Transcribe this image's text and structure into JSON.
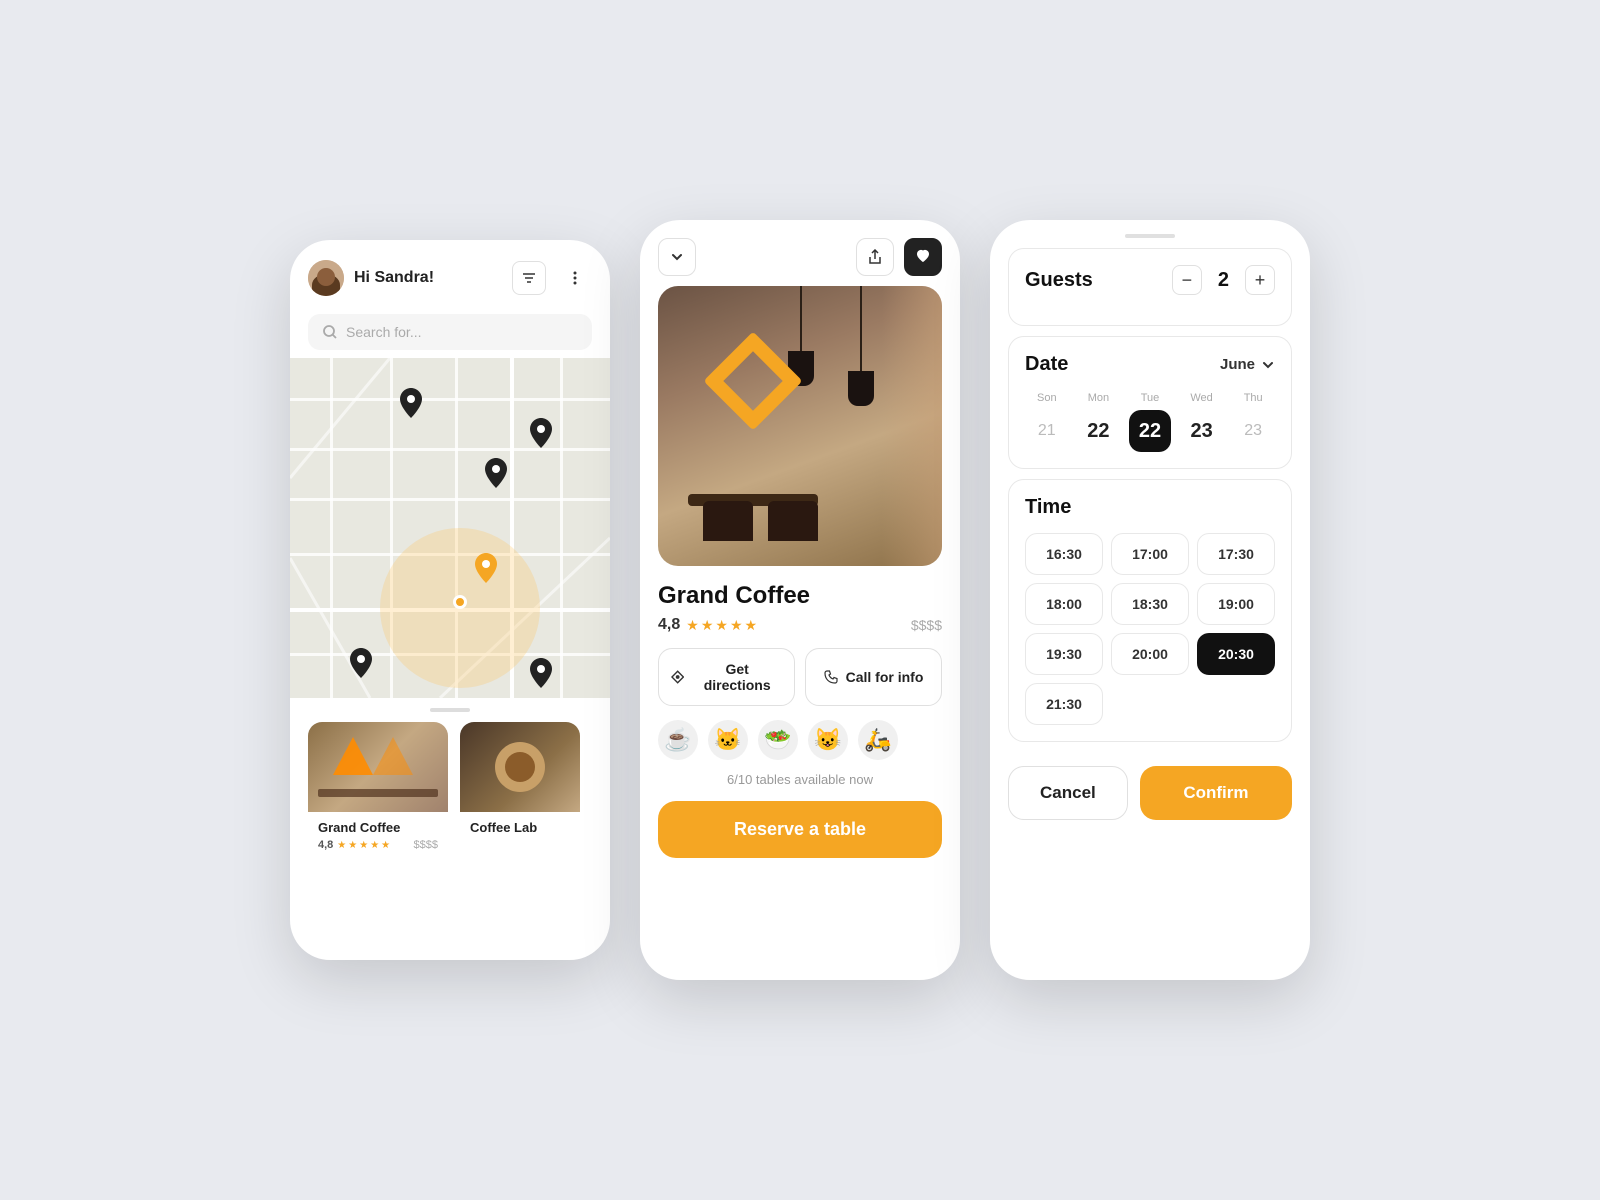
{
  "phone1": {
    "greeting": "Hi Sandra!",
    "search_placeholder": "Search for...",
    "restaurant": {
      "name": "Grand Coffee",
      "rating": "4,8",
      "price": "$$$$"
    }
  },
  "phone2": {
    "restaurant_name": "Grand Coffee",
    "rating": "4,8",
    "price": "$$$$",
    "get_directions_label": "Get directions",
    "call_for_info_label": "Call for info",
    "tables_info": "6/10 tables available now",
    "reserve_label": "Reserve a table",
    "emojis": [
      "☕",
      "🐱",
      "🥗",
      "😺",
      "🛵"
    ]
  },
  "phone3": {
    "guests_label": "Guests",
    "guest_count": "2",
    "minus_label": "−",
    "plus_label": "+",
    "date_label": "Date",
    "month": "June",
    "days": [
      {
        "name": "Son",
        "num": "21",
        "style": "light"
      },
      {
        "name": "Mon",
        "num": "22",
        "style": "normal"
      },
      {
        "name": "Tue",
        "num": "22",
        "style": "selected"
      },
      {
        "name": "Wed",
        "num": "23",
        "style": "normal"
      },
      {
        "name": "Thu",
        "num": "23",
        "style": "light"
      }
    ],
    "time_label": "Time",
    "times": [
      {
        "label": "16:30",
        "selected": false
      },
      {
        "label": "17:00",
        "selected": false
      },
      {
        "label": "17:30",
        "selected": false
      },
      {
        "label": "18:00",
        "selected": false
      },
      {
        "label": "18:30",
        "selected": false
      },
      {
        "label": "19:00",
        "selected": false
      },
      {
        "label": "19:30",
        "selected": false
      },
      {
        "label": "20:00",
        "selected": false
      },
      {
        "label": "20:30",
        "selected": true
      },
      {
        "label": "21:30",
        "selected": false,
        "single": true
      }
    ],
    "cancel_label": "Cancel",
    "confirm_label": "Confirm"
  }
}
